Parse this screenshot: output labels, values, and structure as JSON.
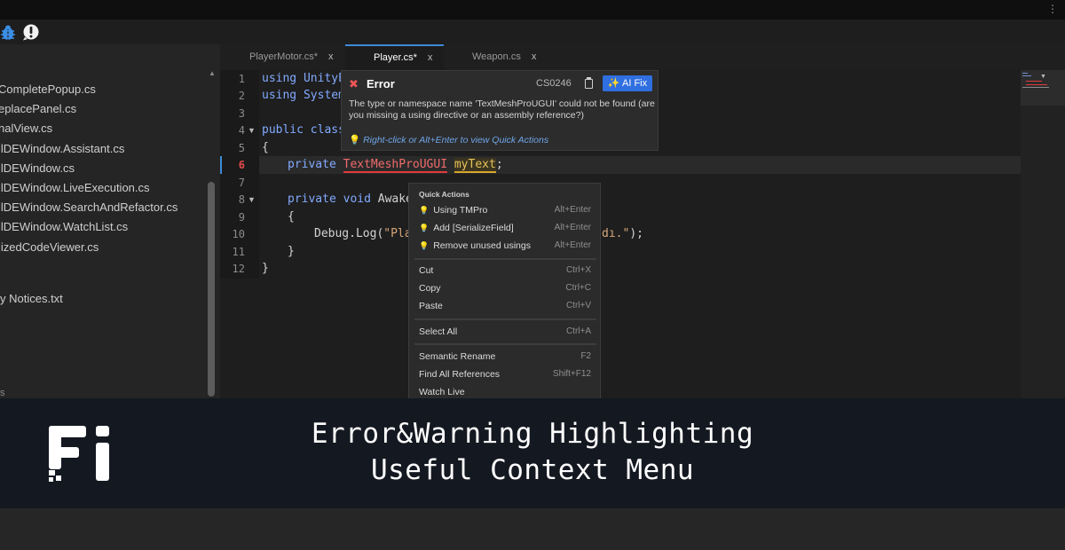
{
  "toolbar": {
    "kebab": "⋮"
  },
  "sidebar": {
    "files": [
      "CompletePopup.cs",
      "eplacePanel.cs",
      "nalView.cs",
      "llDEWindow.Assistant.cs",
      "llDEWindow.cs",
      "llDEWindow.LiveExecution.cs",
      "llDEWindow.SearchAndRefactor.cs",
      "llDEWindow.WatchList.cs",
      "lizedCodeViewer.cs"
    ],
    "notice": "y Notices.txt",
    "partial": "s"
  },
  "tabs": [
    {
      "label": "PlayerMotor.cs*",
      "close": "x"
    },
    {
      "label": "Player.cs*",
      "close": "x"
    },
    {
      "label": "Weapon.cs",
      "close": "x"
    }
  ],
  "editor": {
    "line_numbers": [
      "1",
      "2",
      "3",
      "4",
      "5",
      "6",
      "7",
      "8",
      "9",
      "10",
      "11",
      "12"
    ],
    "lines": {
      "l1": "using UnityE",
      "l2": "using System",
      "l4_kw": "public class",
      "l5": "{",
      "l6_kw": "private",
      "l6_type": "TextMeshProUGUI",
      "l6_var": "myText",
      "l6_end": ";",
      "l8_kw": "private void",
      "l8_rest": " Awake(",
      "l9": "{",
      "l10_a": "Debug.Log(",
      "l10_str_a": "\"Play",
      "l10_str_b": "dı.\"",
      "l10_end": ");",
      "l11": "}",
      "l12": "}"
    }
  },
  "error_popup": {
    "icon": "✖",
    "title": "Error",
    "code": "CS0246",
    "ai_fix": "✨ AI Fix",
    "message": "The type or namespace name 'TextMeshProUGUI' could not be found (are you missing a using directive or an assembly reference?)",
    "hint": "Right-click or Alt+Enter to view Quick Actions"
  },
  "context_menu": {
    "header": "Quick Actions",
    "quick_actions": [
      {
        "label": "Using TMPro",
        "shortcut": "Alt+Enter"
      },
      {
        "label": "Add [SerializeField]",
        "shortcut": "Alt+Enter"
      },
      {
        "label": "Remove unused usings",
        "shortcut": "Alt+Enter"
      }
    ],
    "edit": [
      {
        "label": "Cut",
        "shortcut": "Ctrl+X"
      },
      {
        "label": "Copy",
        "shortcut": "Ctrl+C"
      },
      {
        "label": "Paste",
        "shortcut": "Ctrl+V"
      }
    ],
    "select_all": {
      "label": "Select All",
      "shortcut": "Ctrl+A"
    },
    "refactor": [
      {
        "label": "Semantic Rename",
        "shortcut": "F2"
      },
      {
        "label": "Find All References",
        "shortcut": "Shift+F12"
      },
      {
        "label": "Watch Live",
        "shortcut": ""
      }
    ]
  },
  "banner": {
    "line1": "Error&Warning Highlighting",
    "line2": "Useful Context Menu"
  },
  "colors": {
    "accent": "#3e8bd6",
    "error": "#e03b3b",
    "warning": "#d8a72c",
    "ai_fix": "#2f6fe0",
    "banner_bg": "#141821"
  }
}
